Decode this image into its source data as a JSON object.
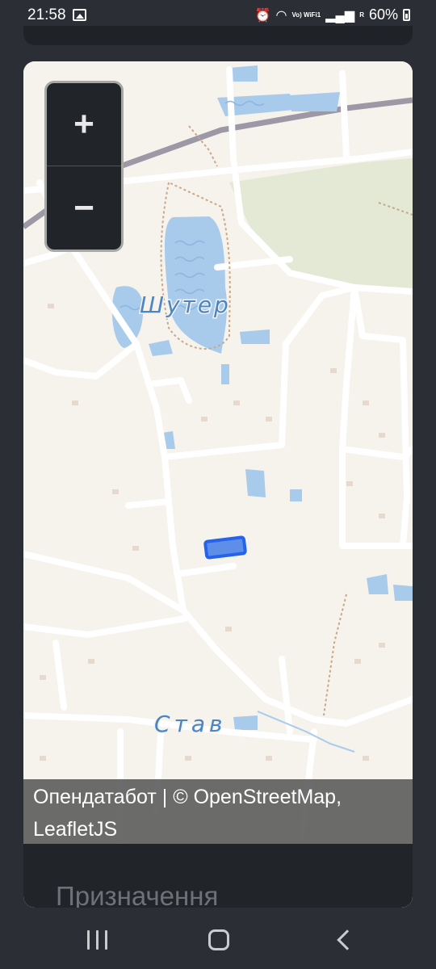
{
  "status_bar": {
    "time": "21:58",
    "battery": "60%",
    "network_label": "Vo) WiFi1",
    "signal_label": "R"
  },
  "map": {
    "labels": {
      "lake_north": "Шутер",
      "lake_south": "Став"
    },
    "zoom_in": "+",
    "zoom_out": "−",
    "attribution_line1": "Опендатабот | © OpenStreetMap,",
    "attribution_line2": "LeafletJS",
    "colors": {
      "land": "#f6f2ec",
      "water": "#a8cbec",
      "road": "#ffffff",
      "railway": "#9c98a6",
      "park": "#e3e9d5",
      "highlight": "#2563eb"
    }
  },
  "section": {
    "title": "Призначення"
  },
  "nav": {
    "recent": "recent-apps",
    "home": "home",
    "back": "back"
  }
}
